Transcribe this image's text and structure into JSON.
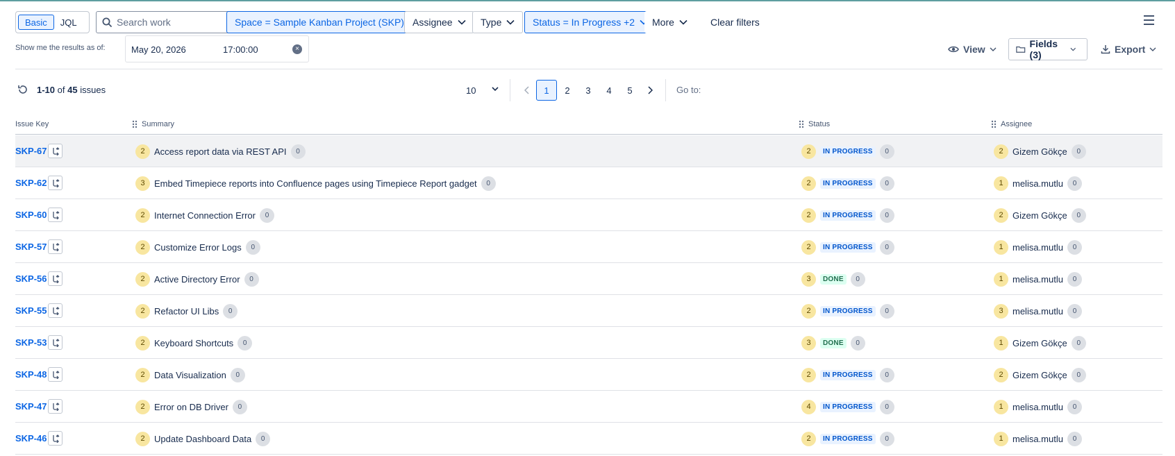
{
  "colors": {
    "accent": "#0c66e4",
    "badge_yellow": "#f8e6a0",
    "badge_gray": "#dcdfe4",
    "in_progress": "#0055cc",
    "done": "#216e4e"
  },
  "mode_toggle": {
    "basic": "Basic",
    "jql": "JQL",
    "selected": "Basic"
  },
  "search": {
    "placeholder": "Search work"
  },
  "filters": {
    "space": "Space = Sample Kanban Project (SKP)",
    "assignee": "Assignee",
    "type": "Type",
    "status": "Status = In Progress +2",
    "more": "More",
    "clear": "Clear filters"
  },
  "asof": {
    "label": "Show me the results as of:",
    "date": "May 20, 2026",
    "time": "17:00:00"
  },
  "toolbar": {
    "view": "View",
    "fields": "Fields (3)",
    "export": "Export"
  },
  "results": {
    "range": "1-10",
    "of": "of",
    "total": "45",
    "unit": "issues"
  },
  "pagination": {
    "per_page": "10",
    "pages": [
      "1",
      "2",
      "3",
      "4",
      "5"
    ],
    "current": "1",
    "goto_label": "Go to:"
  },
  "table": {
    "columns": {
      "key": "Issue Key",
      "summary": "Summary",
      "status": "Status",
      "assignee": "Assignee"
    },
    "rows": [
      {
        "key": "SKP-67",
        "sum_count": "2",
        "summary": "Access report data via REST API",
        "sum_zero": "0",
        "status_count": "2",
        "status": "IN PROGRESS",
        "status_zero": "0",
        "asg_count": "2",
        "assignee": "Gizem Gökçe",
        "asg_zero": "0"
      },
      {
        "key": "SKP-62",
        "sum_count": "3",
        "summary": "Embed Timepiece reports into Confluence pages using Timepiece Report gadget",
        "sum_zero": "0",
        "status_count": "2",
        "status": "IN PROGRESS",
        "status_zero": "0",
        "asg_count": "1",
        "assignee": "melisa.mutlu",
        "asg_zero": "0"
      },
      {
        "key": "SKP-60",
        "sum_count": "2",
        "summary": "Internet Connection Error",
        "sum_zero": "0",
        "status_count": "2",
        "status": "IN PROGRESS",
        "status_zero": "0",
        "asg_count": "2",
        "assignee": "Gizem Gökçe",
        "asg_zero": "0"
      },
      {
        "key": "SKP-57",
        "sum_count": "2",
        "summary": "Customize Error Logs",
        "sum_zero": "0",
        "status_count": "2",
        "status": "IN PROGRESS",
        "status_zero": "0",
        "asg_count": "1",
        "assignee": "melisa.mutlu",
        "asg_zero": "0"
      },
      {
        "key": "SKP-56",
        "sum_count": "2",
        "summary": "Active Directory Error",
        "sum_zero": "0",
        "status_count": "3",
        "status": "DONE",
        "status_zero": "0",
        "asg_count": "1",
        "assignee": "melisa.mutlu",
        "asg_zero": "0"
      },
      {
        "key": "SKP-55",
        "sum_count": "2",
        "summary": "Refactor UI Libs",
        "sum_zero": "0",
        "status_count": "2",
        "status": "IN PROGRESS",
        "status_zero": "0",
        "asg_count": "3",
        "assignee": "melisa.mutlu",
        "asg_zero": "0"
      },
      {
        "key": "SKP-53",
        "sum_count": "2",
        "summary": "Keyboard Shortcuts",
        "sum_zero": "0",
        "status_count": "3",
        "status": "DONE",
        "status_zero": "0",
        "asg_count": "1",
        "assignee": "Gizem Gökçe",
        "asg_zero": "0"
      },
      {
        "key": "SKP-48",
        "sum_count": "2",
        "summary": "Data Visualization",
        "sum_zero": "0",
        "status_count": "2",
        "status": "IN PROGRESS",
        "status_zero": "0",
        "asg_count": "2",
        "assignee": "Gizem Gökçe",
        "asg_zero": "0"
      },
      {
        "key": "SKP-47",
        "sum_count": "2",
        "summary": "Error on DB Driver",
        "sum_zero": "0",
        "status_count": "4",
        "status": "IN PROGRESS",
        "status_zero": "0",
        "asg_count": "1",
        "assignee": "melisa.mutlu",
        "asg_zero": "0"
      },
      {
        "key": "SKP-46",
        "sum_count": "2",
        "summary": "Update Dashboard Data",
        "sum_zero": "0",
        "status_count": "2",
        "status": "IN PROGRESS",
        "status_zero": "0",
        "asg_count": "1",
        "assignee": "melisa.mutlu",
        "asg_zero": "0"
      }
    ]
  }
}
